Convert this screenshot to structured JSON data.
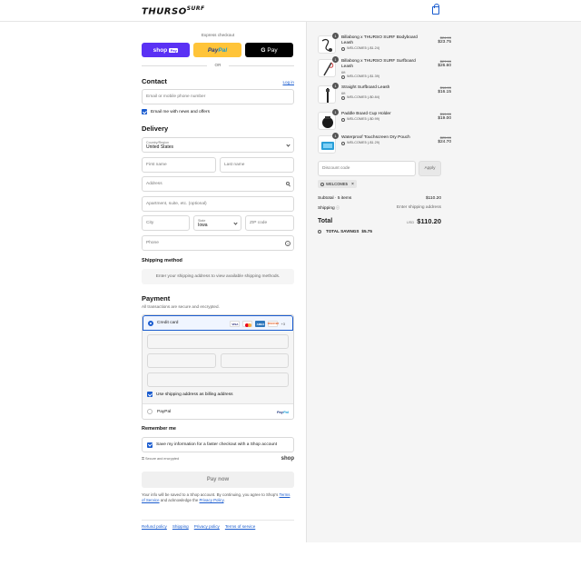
{
  "header": {
    "logo_main": "THURSO",
    "logo_sup": "SURF"
  },
  "express": {
    "label": "Express checkout",
    "shop_pay": "shop",
    "shop_pay_tag": "Pay",
    "paypal_a": "Pay",
    "paypal_b": "Pal",
    "gpay_g": "G",
    "gpay_text": "Pay",
    "or": "OR"
  },
  "contact": {
    "title": "Contact",
    "login": "Log in",
    "placeholder": "Email or mobile phone number",
    "news_label": "Email me with news and offers"
  },
  "delivery": {
    "title": "Delivery",
    "country_label": "Country/Region",
    "country_value": "United States",
    "first_name": "First name",
    "last_name": "Last name",
    "address": "Address",
    "apartment": "Apartment, suite, etc. (optional)",
    "city": "City",
    "state_label": "State",
    "state_value": "Iowa",
    "zip": "ZIP code",
    "phone": "Phone"
  },
  "shipping": {
    "title": "Shipping method",
    "message": "Enter your shipping address to view available shipping methods."
  },
  "payment": {
    "title": "Payment",
    "subtitle": "All transactions are secure and encrypted.",
    "credit_card": "Credit card",
    "card_brands": [
      "VISA",
      "",
      "AMEX",
      "DISCOVER"
    ],
    "more_cards": "+3",
    "billing_same": "Use shipping address as billing address",
    "paypal": "PayPal",
    "paypal_logo_a": "Pay",
    "paypal_logo_b": "Pal"
  },
  "remember": {
    "title": "Remember me",
    "label": "Save my information for a faster checkout with a Shop account",
    "secure": "Secure and encrypted",
    "shop": "shop"
  },
  "pay_now": "Pay now",
  "legal": {
    "text1": "Your info will be saved to a Shop account. By continuing, you agree to Shop’s",
    "terms": "Terms of Service",
    "text2": "and acknowledge the",
    "privacy": "Privacy Policy",
    "text3": "."
  },
  "footer": [
    "Refund policy",
    "Shipping",
    "Privacy policy",
    "Terms of service"
  ],
  "cart": {
    "items": [
      {
        "qty": "1",
        "name": "Billabong x THURSO SURF Bodyboard Leash",
        "variant": "",
        "discount": "WELCOME5 (-$1.24)",
        "old": "$24.99",
        "price": "$23.75"
      },
      {
        "qty": "1",
        "name": "Billabong x THURSO SURF Surfboard Leash",
        "variant": "6ft",
        "discount": "WELCOME5 (-$1.39)",
        "old": "$27.99",
        "price": "$26.60"
      },
      {
        "qty": "1",
        "name": "Straight Surfboard Leash",
        "variant": "6ft",
        "discount": "WELCOME5 (-$0.84)",
        "old": "$16.99",
        "price": "$16.15"
      },
      {
        "qty": "1",
        "name": "Paddle Board Cup Holder",
        "variant": "",
        "discount": "WELCOME5 (-$0.99)",
        "old": "$19.99",
        "price": "$19.00"
      },
      {
        "qty": "1",
        "name": "Waterproof Touchscreen Dry Pouch",
        "variant": "",
        "discount": "WELCOME5 (-$1.29)",
        "old": "$25.99",
        "price": "$24.70"
      }
    ],
    "discount_placeholder": "Discount code",
    "apply": "Apply",
    "applied_code": "WELCOME5",
    "subtotal_label": "Subtotal · 5 items",
    "subtotal": "$110.20",
    "shipping_label": "Shipping",
    "shipping_value": "Enter shipping address",
    "total_label": "Total",
    "currency": "USD",
    "total": "$110.20",
    "savings_label": "TOTAL SAVINGS",
    "savings": "$5.75"
  }
}
